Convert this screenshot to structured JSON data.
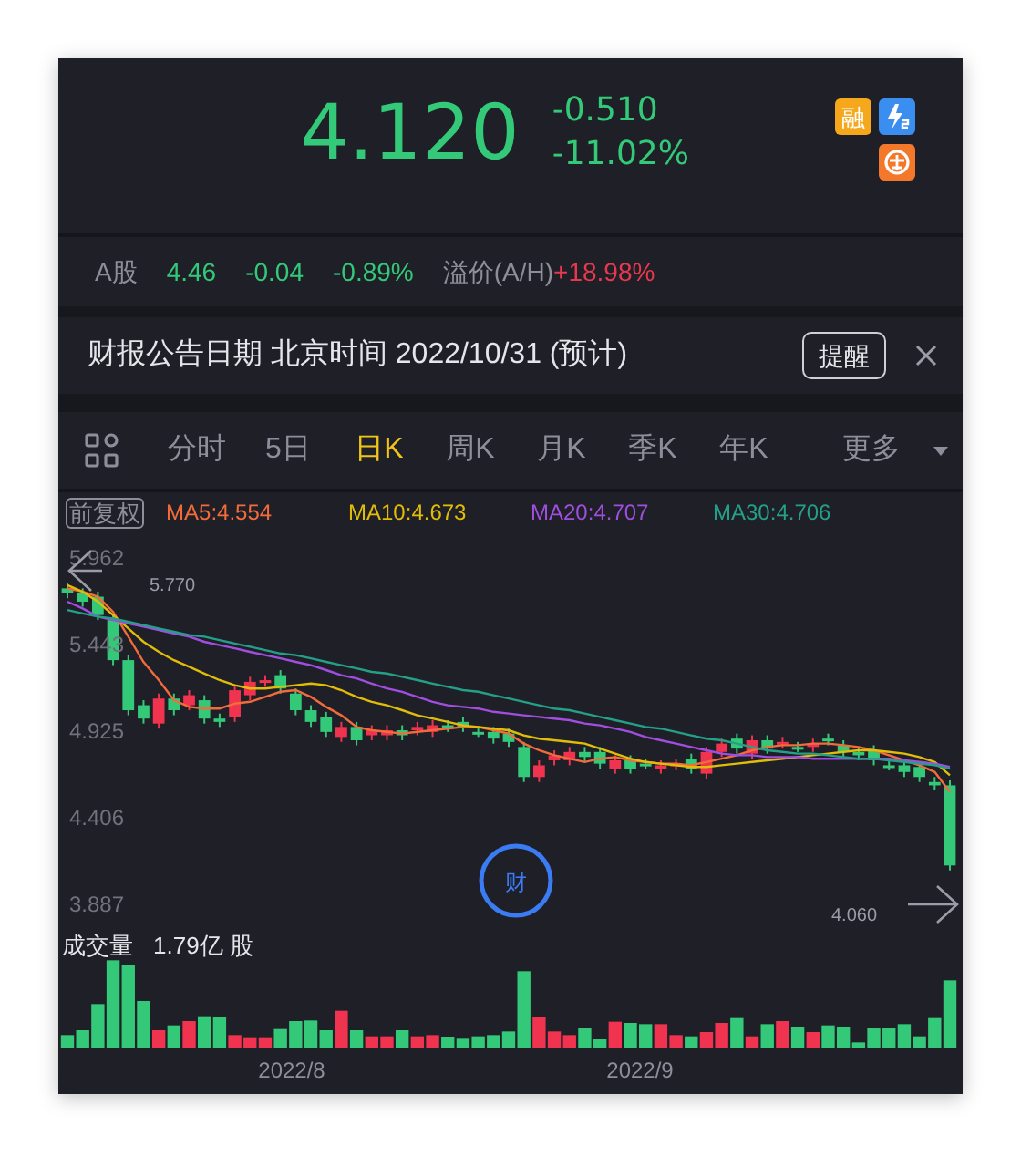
{
  "quote": {
    "price": "4.120",
    "change": "-0.510",
    "change_pct": "-11.02%",
    "badges": [
      {
        "kind": "text",
        "label": "融",
        "color": "#f5a81c"
      },
      {
        "kind": "lightning",
        "color": "#3a8ef0"
      },
      {
        "kind": "glyph",
        "color": "#f4782a"
      }
    ]
  },
  "a_share": {
    "label": "A股",
    "price": "4.46",
    "change": "-0.04",
    "change_pct": "-0.89%",
    "premium_label": "溢价(A/H)",
    "premium": "+18.98%"
  },
  "notice": {
    "text": "财报公告日期 北京时间 2022/10/31 (预计)",
    "button": "提醒"
  },
  "tabs": [
    {
      "label": "分时",
      "selected": false,
      "kind": "tab"
    },
    {
      "label": "5日",
      "selected": false,
      "kind": "tab"
    },
    {
      "label": "日K",
      "selected": true,
      "kind": "tab"
    },
    {
      "label": "周K",
      "selected": false,
      "kind": "tab"
    },
    {
      "label": "月K",
      "selected": false,
      "kind": "tab"
    },
    {
      "label": "季K",
      "selected": false,
      "kind": "tab"
    },
    {
      "label": "年K",
      "selected": false,
      "kind": "tab"
    },
    {
      "label": "更多",
      "selected": false,
      "kind": "dropdown"
    }
  ],
  "chart": {
    "high_label": "5.770",
    "low_label": "4.060",
    "event_marker": "财",
    "volume_label": "成交量",
    "volume_value": "1.79亿 股",
    "x_labels": [
      "2022/8",
      "2022/9"
    ],
    "chart_data": {
      "type": "candlestick",
      "ylim": [
        2.751,
        8.955
      ],
      "yticks": [
        {
          "value": 5.962,
          "label": "5.962"
        },
        {
          "value": 5.443,
          "label": "5.443"
        },
        {
          "value": 4.925,
          "label": "4.925"
        },
        {
          "value": 4.406,
          "label": "4.406"
        },
        {
          "value": 3.887,
          "label": "3.887"
        }
      ],
      "ohlc": [
        [
          5.78,
          5.81,
          5.72,
          5.75
        ],
        [
          5.75,
          5.78,
          5.67,
          5.7
        ],
        [
          5.73,
          5.76,
          5.59,
          5.62
        ],
        [
          5.59,
          5.62,
          5.32,
          5.35
        ],
        [
          5.35,
          5.38,
          5.02,
          5.05
        ],
        [
          5.08,
          5.11,
          4.97,
          5.0
        ],
        [
          4.97,
          5.15,
          4.94,
          5.12
        ],
        [
          5.12,
          5.15,
          5.02,
          5.05
        ],
        [
          5.08,
          5.17,
          5.05,
          5.14
        ],
        [
          5.11,
          5.14,
          4.97,
          5.0
        ],
        [
          5.0,
          5.03,
          4.95,
          4.98
        ],
        [
          5.01,
          5.2,
          4.98,
          5.17
        ],
        [
          5.14,
          5.25,
          5.11,
          5.22
        ],
        [
          5.22,
          5.26,
          5.19,
          5.23
        ],
        [
          5.26,
          5.29,
          5.15,
          5.18
        ],
        [
          5.15,
          5.18,
          5.02,
          5.05
        ],
        [
          5.05,
          5.08,
          4.95,
          4.98
        ],
        [
          5.01,
          5.04,
          4.89,
          4.92
        ],
        [
          4.89,
          4.98,
          4.86,
          4.95
        ],
        [
          4.95,
          4.98,
          4.84,
          4.87
        ],
        [
          4.9,
          4.96,
          4.87,
          4.93
        ],
        [
          4.9,
          4.96,
          4.87,
          4.93
        ],
        [
          4.93,
          4.96,
          4.87,
          4.9
        ],
        [
          4.93,
          4.98,
          4.9,
          4.95
        ],
        [
          4.92,
          4.99,
          4.89,
          4.96
        ],
        [
          4.96,
          4.99,
          4.92,
          4.95
        ],
        [
          4.98,
          5.01,
          4.92,
          4.95
        ],
        [
          4.92,
          4.95,
          4.89,
          4.92
        ],
        [
          4.92,
          4.95,
          4.85,
          4.88
        ],
        [
          4.91,
          4.94,
          4.83,
          4.86
        ],
        [
          4.83,
          4.86,
          4.62,
          4.65
        ],
        [
          4.65,
          4.75,
          4.62,
          4.72
        ],
        [
          4.75,
          4.81,
          4.72,
          4.78
        ],
        [
          4.75,
          4.83,
          4.72,
          4.8
        ],
        [
          4.8,
          4.83,
          4.74,
          4.77
        ],
        [
          4.8,
          4.83,
          4.7,
          4.73
        ],
        [
          4.7,
          4.78,
          4.67,
          4.75
        ],
        [
          4.75,
          4.78,
          4.67,
          4.7
        ],
        [
          4.73,
          4.76,
          4.7,
          4.73
        ],
        [
          4.7,
          4.75,
          4.67,
          4.72
        ],
        [
          4.72,
          4.76,
          4.69,
          4.73
        ],
        [
          4.76,
          4.79,
          4.67,
          4.7
        ],
        [
          4.67,
          4.83,
          4.64,
          4.8
        ],
        [
          4.8,
          4.88,
          4.77,
          4.85
        ],
        [
          4.88,
          4.91,
          4.79,
          4.82
        ],
        [
          4.79,
          4.9,
          4.76,
          4.87
        ],
        [
          4.87,
          4.9,
          4.79,
          4.82
        ],
        [
          4.85,
          4.89,
          4.82,
          4.86
        ],
        [
          4.83,
          4.86,
          4.8,
          4.83
        ],
        [
          4.83,
          4.88,
          4.8,
          4.85
        ],
        [
          4.88,
          4.91,
          4.84,
          4.87
        ],
        [
          4.84,
          4.87,
          4.77,
          4.8
        ],
        [
          4.8,
          4.83,
          4.75,
          4.78
        ],
        [
          4.81,
          4.84,
          4.72,
          4.75
        ],
        [
          4.72,
          4.75,
          4.69,
          4.72
        ],
        [
          4.72,
          4.75,
          4.65,
          4.68
        ],
        [
          4.71,
          4.74,
          4.62,
          4.65
        ],
        [
          4.62,
          4.65,
          4.57,
          4.6
        ],
        [
          4.6,
          4.63,
          4.09,
          4.12
        ]
      ]
    }
  },
  "ma": {
    "adjust": "前复权",
    "values": [
      ":4.554",
      ":4.673",
      ":4.707",
      ":4.706"
    ],
    "chart_data": {
      "type": "line",
      "ylim": [
        2.751,
        8.955
      ],
      "series": [
        {
          "name": "MA5",
          "color": "#f26b3a",
          "values": [
            5.78,
            5.76,
            5.73,
            5.64,
            5.49,
            5.34,
            5.23,
            5.11,
            5.07,
            5.06,
            5.06,
            5.09,
            5.1,
            5.13,
            5.16,
            5.17,
            5.13,
            5.07,
            5.02,
            4.95,
            4.93,
            4.92,
            4.91,
            4.92,
            4.93,
            4.94,
            4.95,
            4.95,
            4.93,
            4.91,
            4.85,
            4.81,
            4.78,
            4.76,
            4.74,
            4.76,
            4.77,
            4.75,
            4.74,
            4.73,
            4.73,
            4.72,
            4.74,
            4.76,
            4.78,
            4.81,
            4.83,
            4.84,
            4.84,
            4.85,
            4.85,
            4.84,
            4.83,
            4.81,
            4.78,
            4.75,
            4.72,
            4.68,
            4.56
          ]
        },
        {
          "name": "MA10",
          "color": "#e2bd08",
          "values": [
            5.8,
            5.76,
            5.7,
            5.62,
            5.54,
            5.46,
            5.4,
            5.35,
            5.31,
            5.27,
            5.23,
            5.2,
            5.18,
            5.18,
            5.19,
            5.2,
            5.21,
            5.2,
            5.17,
            5.13,
            5.1,
            5.08,
            5.05,
            5.02,
            5.0,
            4.98,
            4.96,
            4.95,
            4.94,
            4.93,
            4.9,
            4.88,
            4.87,
            4.86,
            4.85,
            4.82,
            4.79,
            4.76,
            4.74,
            4.73,
            4.72,
            4.71,
            4.71,
            4.72,
            4.73,
            4.74,
            4.75,
            4.76,
            4.77,
            4.78,
            4.79,
            4.8,
            4.81,
            4.81,
            4.8,
            4.79,
            4.77,
            4.74,
            4.66
          ]
        },
        {
          "name": "MA20",
          "color": "#a14ee0",
          "values": [
            5.7,
            5.66,
            5.61,
            5.59,
            5.57,
            5.55,
            5.53,
            5.51,
            5.49,
            5.46,
            5.44,
            5.42,
            5.4,
            5.38,
            5.36,
            5.34,
            5.32,
            5.29,
            5.26,
            5.24,
            5.21,
            5.18,
            5.16,
            5.13,
            5.1,
            5.08,
            5.07,
            5.06,
            5.04,
            5.03,
            5.02,
            5.01,
            5.0,
            4.99,
            4.97,
            4.96,
            4.94,
            4.92,
            4.89,
            4.87,
            4.85,
            4.83,
            4.81,
            4.79,
            4.78,
            4.78,
            4.77,
            4.77,
            4.77,
            4.76,
            4.76,
            4.76,
            4.76,
            4.76,
            4.76,
            4.75,
            4.74,
            4.73,
            4.71
          ]
        },
        {
          "name": "MA30",
          "color": "#25a088",
          "values": [
            5.65,
            5.63,
            5.61,
            5.6,
            5.58,
            5.56,
            5.54,
            5.52,
            5.5,
            5.49,
            5.47,
            5.45,
            5.43,
            5.41,
            5.39,
            5.38,
            5.36,
            5.34,
            5.32,
            5.3,
            5.28,
            5.27,
            5.25,
            5.23,
            5.21,
            5.19,
            5.17,
            5.16,
            5.14,
            5.12,
            5.1,
            5.08,
            5.06,
            5.05,
            5.03,
            5.01,
            4.99,
            4.97,
            4.95,
            4.94,
            4.92,
            4.9,
            4.88,
            4.87,
            4.85,
            4.83,
            4.81,
            4.8,
            4.79,
            4.79,
            4.78,
            4.77,
            4.76,
            4.76,
            4.75,
            4.74,
            4.73,
            4.72,
            4.7
          ]
        }
      ]
    }
  }
}
